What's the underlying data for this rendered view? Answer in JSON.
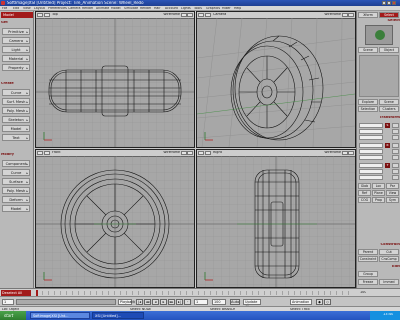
{
  "window": {
    "title": "SoftImage|XSI [Untitled] Project: Tire_Animation  Scene: Wheel_Redo"
  },
  "menu": [
    "File",
    "Edit",
    "View",
    "Layout",
    "Preferences",
    "Camera",
    "Render",
    "Animate",
    "Model",
    "Simulate",
    "Render",
    "Hair",
    "Account",
    "Lights",
    "Tools",
    "Graphics",
    "Mixer",
    "Help"
  ],
  "left_panel": {
    "mode": "Model",
    "sections": [
      {
        "label": "Get",
        "items": [
          "Primitive",
          "Camera",
          "Light",
          "Material",
          "Property"
        ]
      },
      {
        "label": "Create",
        "items": [
          "Curve",
          "Surf. Mesh",
          "Poly. Mesh",
          "Skeleton",
          "Model",
          "Text"
        ]
      },
      {
        "label": "Modify",
        "items": [
          "Component",
          "Curve",
          "Surface",
          "Poly. Mesh",
          "Deform",
          "Model"
        ]
      }
    ]
  },
  "viewports": [
    {
      "name": "Top",
      "menu": "Wireframe"
    },
    {
      "name": "Camera",
      "menu": "Wireframe"
    },
    {
      "name": "Front",
      "menu": "Wireframe"
    },
    {
      "name": "Right",
      "menu": "Wireframe"
    }
  ],
  "right_panel": {
    "tabs": [
      "Xform",
      "Select"
    ],
    "scene_label": "Select",
    "buttons_top": [
      "Scene",
      "Object"
    ],
    "explore": [
      "Explore",
      "Scene"
    ],
    "selection": [
      "Selection",
      "Clusters"
    ],
    "transform_label": "Transform",
    "transform_rows": [
      "S",
      "R",
      "T"
    ],
    "transform_buttons": [
      "Glob",
      "Loc",
      "Par",
      "Ref",
      "Plane",
      "View"
    ],
    "mode_buttons": [
      "COG",
      "Prop",
      "Sym"
    ],
    "constrain_label": "Constrain",
    "constrain_buttons": [
      "Parent",
      "Cut",
      "Constraint",
      "CnsComp"
    ],
    "edit_label": "Edit",
    "edit_buttons": [
      "Group",
      "Freeze",
      "Immed"
    ],
    "slider_labels": [
      "Snap",
      "Deform",
      "Mode"
    ]
  },
  "timeline": {
    "label": "Deselect All",
    "start": "1",
    "end": "100",
    "frame": "1"
  },
  "playback": {
    "playback_label": "Playback",
    "current_frame": "1",
    "end_frame": "100",
    "autokey_label": "Auto",
    "update_label": "Update All",
    "animation_label": "Animation"
  },
  "status": {
    "text": "Lot: Object",
    "select": "Select: NODE",
    "select2": "Select: BRANCH",
    "select3": "Select: TREE"
  },
  "taskbar": {
    "start": "start",
    "items": [
      "Softimage|XSI [Unt...",
      "XSI [Untitled]..."
    ],
    "clock": "13:40"
  },
  "colors": {
    "accent": "#7a1010",
    "titlebar": "#1e3f92",
    "grid": "#8f8f8f",
    "wire": "#151515"
  }
}
